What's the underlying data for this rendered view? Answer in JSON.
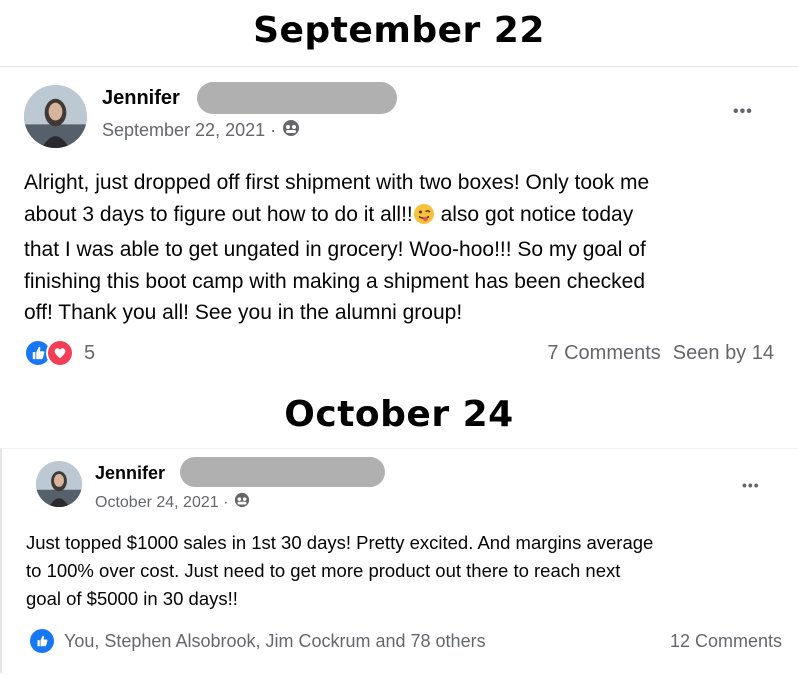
{
  "headings": {
    "first": "September 22",
    "second": "October 24"
  },
  "post1": {
    "author": "Jennifer",
    "date": "September 22, 2021 ·",
    "text_line1": "Alright, just dropped off first shipment with two boxes! Only took me",
    "text_line2a": "about 3 days to figure out how to do it all!!",
    "text_line2b": " also got notice today",
    "text_line3": "that I was able to get ungated in grocery! Woo-hoo!!! So my goal of",
    "text_line4": "finishing this boot camp with making a shipment has been checked",
    "text_line5": "off! Thank you all! See you in the alumni group!",
    "reaction_count": "5",
    "comments": "7 Comments",
    "seen_by": "Seen by 14",
    "more": "•••"
  },
  "post2": {
    "author": "Jennifer",
    "date": "October 24, 2021 ·",
    "text_line1": "Just topped $1000 sales in 1st 30 days! Pretty excited. And margins average",
    "text_line2": "to 100% over cost. Just need to get more product out there to reach next",
    "text_line3": "goal of $5000 in 30 days!!",
    "reactors": "You, Stephen Alsobrook, Jim Cockrum and 78 others",
    "comments": "12 Comments",
    "more": "•••"
  },
  "colors": {
    "like_blue": "#1877f2",
    "love_red": "#f33e58",
    "secondary_text": "#65676b",
    "redaction_gray": "#b0b0b0"
  },
  "icons": {
    "audience": "group-icon",
    "like": "thumbs-up-icon",
    "love": "heart-icon",
    "emoji": "winking-tongue-emoji",
    "more": "more-options-icon"
  }
}
